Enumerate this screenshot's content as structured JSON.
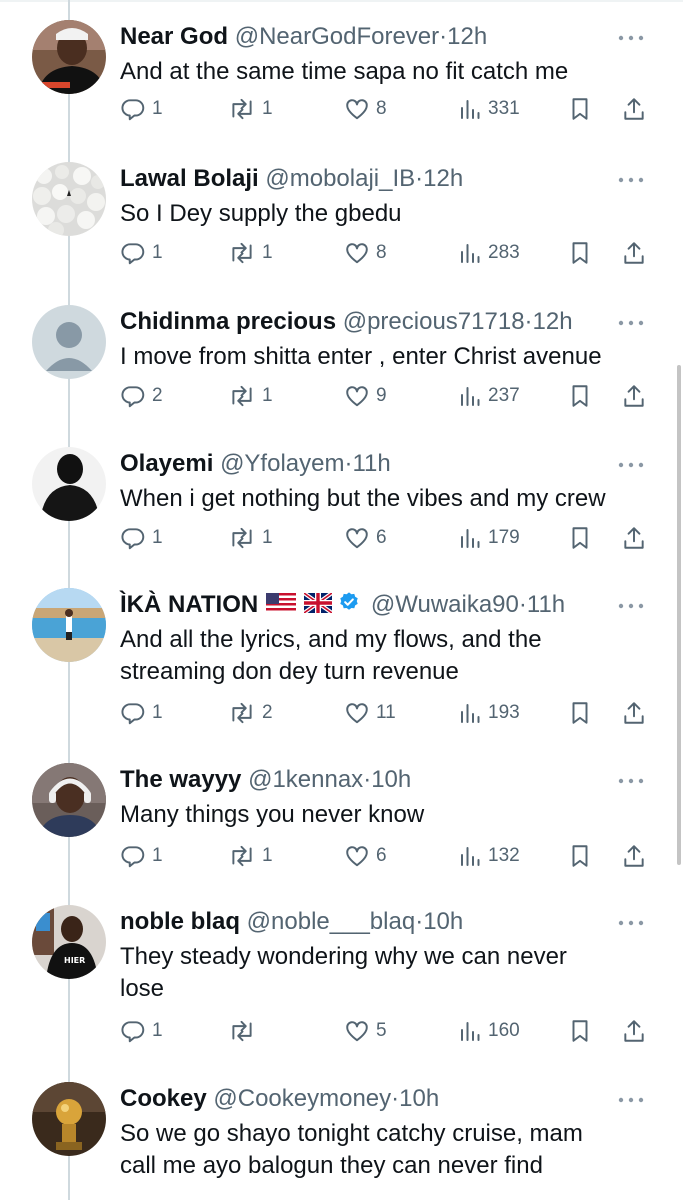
{
  "replies": [
    {
      "name": "Near God",
      "handle": "@NearGodForever",
      "dot": "·",
      "time": "12h",
      "text_lines": [
        "And at the same time sapa no fit catch me"
      ],
      "reply_count": "1",
      "retweet_count": "1",
      "like_count": "8",
      "view_count": "331",
      "avatar_icon": "avatar-photo-man-black-shirt"
    },
    {
      "name": "Lawal Bolaji",
      "handle": "@mobolaji_IB",
      "dot": "·",
      "time": "12h",
      "text_lines": [
        "So I Dey supply the gbedu"
      ],
      "reply_count": "1",
      "retweet_count": "1",
      "like_count": "8",
      "view_count": "283",
      "avatar_icon": "avatar-photo-white-pebbles"
    },
    {
      "name": "Chidinma precious",
      "handle": "@precious71718",
      "dot": "·",
      "time": "12h",
      "text_lines": [
        "I move  from shitta enter , enter Christ avenue"
      ],
      "reply_count": "2",
      "retweet_count": "1",
      "like_count": "9",
      "view_count": "237",
      "avatar_icon": "default-avatar-icon"
    },
    {
      "name": "Olayemi",
      "handle": "@Yfolayem",
      "dot": "·",
      "time": "11h",
      "text_lines": [
        "When i get nothing but the vibes and my crew"
      ],
      "reply_count": "1",
      "retweet_count": "1",
      "like_count": "6",
      "view_count": "179",
      "avatar_icon": "avatar-photo-silhouette"
    },
    {
      "name": "ÌKÀ NATION",
      "handle": "@Wuwaika90",
      "dot": "·",
      "time": "11h",
      "flags": [
        "us-flag",
        "uk-flag"
      ],
      "verified": true,
      "text_lines": [
        "And all the lyrics, and my flows, and the",
        "streaming don dey turn revenue"
      ],
      "reply_count": "1",
      "retweet_count": "2",
      "like_count": "11",
      "view_count": "193",
      "avatar_icon": "avatar-photo-poolside"
    },
    {
      "name": "The wayyy",
      "handle": "@1kennax",
      "dot": "·",
      "time": "10h",
      "text_lines": [
        "Many things you never know"
      ],
      "reply_count": "1",
      "retweet_count": "1",
      "like_count": "6",
      "view_count": "132",
      "avatar_icon": "avatar-photo-headphones"
    },
    {
      "name": "noble blaq",
      "handle": "@noble___blaq",
      "dot": "·",
      "time": "10h",
      "text_lines": [
        "They steady wondering why we can never",
        "lose"
      ],
      "reply_count": "1",
      "retweet_count": "",
      "like_count": "5",
      "view_count": "160",
      "avatar_icon": "avatar-photo-hier-shirt"
    },
    {
      "name": "Cookey",
      "handle": "@Cookeymoney",
      "dot": "·",
      "time": "10h",
      "text_lines": [
        "So we go shayo tonight catchy cruise, mam",
        "call me ayo balogun they can never find"
      ],
      "avatar_icon": "avatar-photo-trophy"
    }
  ],
  "colors": {
    "text": "#0f1419",
    "secondary": "#536471",
    "verified": "#1d9bf0",
    "thread_line": "#cfd9de"
  }
}
